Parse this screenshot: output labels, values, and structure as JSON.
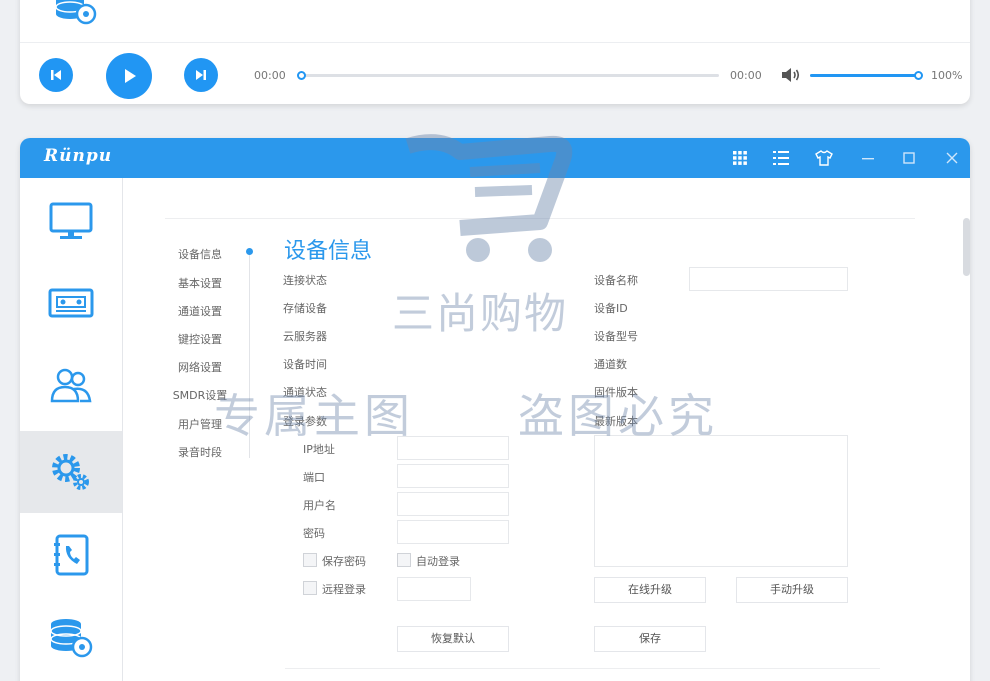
{
  "player": {
    "time_current": "00:00",
    "time_total": "00:00",
    "progress_fraction": 0.0,
    "volume_fraction": 1.0,
    "volume_label": "100%",
    "icons": [
      "database-disc-icon",
      "prev-icon",
      "play-icon",
      "next-icon",
      "speaker-icon"
    ]
  },
  "window": {
    "brand": "Rünpu",
    "accent_color": "#2b98ec",
    "titlebar_icons": [
      "grid-icon",
      "list-icon",
      "shirt-icon",
      "minimize-icon",
      "maximize-icon",
      "close-icon"
    ]
  },
  "sidebar": {
    "items": [
      {
        "icon": "monitor-icon",
        "active": false
      },
      {
        "icon": "recorder-icon",
        "active": false
      },
      {
        "icon": "users-icon",
        "active": false
      },
      {
        "icon": "settings-gears-icon",
        "active": true
      },
      {
        "icon": "phone-book-icon",
        "active": false
      },
      {
        "icon": "database-disc-icon",
        "active": false
      }
    ]
  },
  "subnav": {
    "items": [
      "设备信息",
      "基本设置",
      "通道设置",
      "键控设置",
      "网络设置",
      "SMDR设置",
      "用户管理",
      "录音时段"
    ],
    "active_index": 0
  },
  "device_info": {
    "title": "设备信息",
    "left_labels": [
      "连接状态",
      "存储设备",
      "云服务器",
      "设备时间",
      "通道状态",
      "登录参数"
    ],
    "login": {
      "ip_label": "IP地址",
      "port_label": "端口",
      "user_label": "用户名",
      "password_label": "密码",
      "save_password_label": "保存密码",
      "auto_login_label": "自动登录",
      "remote_login_label": "远程登录",
      "restore_default_label": "恢复默认"
    },
    "right_labels": [
      "设备名称",
      "设备ID",
      "设备型号",
      "通道数",
      "固件版本",
      "最新版本"
    ],
    "online_upgrade_label": "在线升级",
    "manual_upgrade_label": "手动升级",
    "save_label": "保存"
  },
  "watermark": {
    "brand": "三尚购物",
    "slogan_1": "专属主图",
    "slogan_2": "盗图必究"
  }
}
